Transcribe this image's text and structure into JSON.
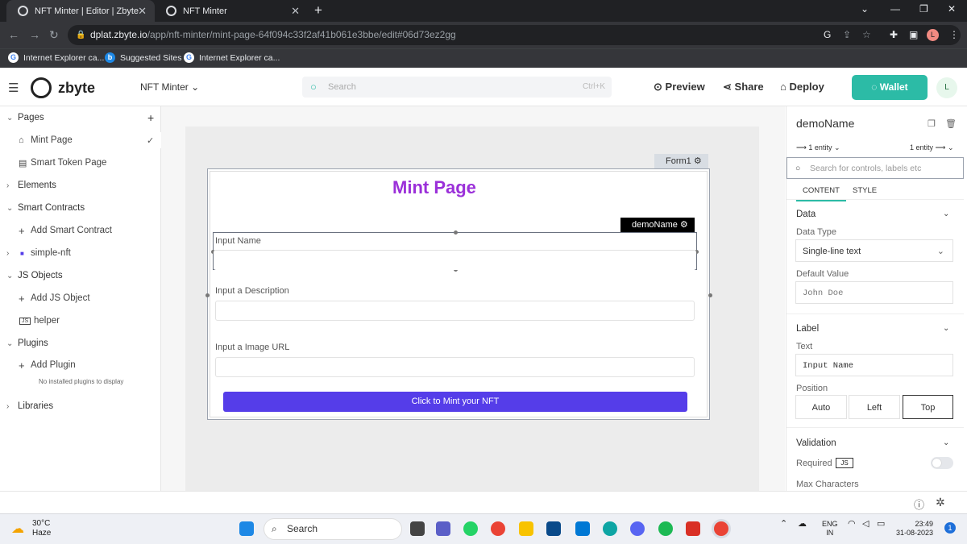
{
  "browser": {
    "tabs": [
      {
        "title": "NFT Minter | Editor | Zbyte"
      },
      {
        "title": "NFT Minter"
      }
    ],
    "url_host": "dplat.zbyte.io",
    "url_path": "/app/nft-minter/mint-page-64f094c33f2af41b061e3bbe/edit#06d73ez2gg",
    "profile_initial": "L",
    "bookmarks": [
      "Internet Explorer ca...",
      "Suggested Sites",
      "Internet Explorer ca..."
    ]
  },
  "topbar": {
    "brand": "zbyte",
    "app_name": "NFT Minter",
    "search_placeholder": "Search",
    "search_shortcut": "Ctrl+K",
    "preview": "Preview",
    "share": "Share",
    "deploy": "Deploy",
    "wallet": "Wallet",
    "avatar": "L"
  },
  "sidebar": {
    "pages_header": "Pages",
    "pages": [
      "Mint Page",
      "Smart Token Page"
    ],
    "elements": "Elements",
    "smart_contracts": "Smart Contracts",
    "add_smart_contract": "Add Smart Contract",
    "contract": "simple-nft",
    "js_objects": "JS Objects",
    "add_js_object": "Add JS Object",
    "js_item": "helper",
    "plugins": "Plugins",
    "add_plugin": "Add Plugin",
    "no_plugins": "No installed plugins to display",
    "libraries": "Libraries"
  },
  "canvas": {
    "form_tag": "Form1",
    "title": "Mint Page",
    "selected_tag": "demoName",
    "fields": [
      {
        "label": "Input Name"
      },
      {
        "label": "Input a Description"
      },
      {
        "label": "Input a Image URL"
      }
    ],
    "submit": "Click to Mint your NFT"
  },
  "properties": {
    "widget_name": "demoName",
    "entity_left": "1 entity",
    "entity_right": "1 entity",
    "search_placeholder": "Search for controls, labels etc",
    "tab_content": "CONTENT",
    "tab_style": "STYLE",
    "data_section": "Data",
    "data_type_label": "Data Type",
    "data_type_value": "Single-line text",
    "default_value_label": "Default Value",
    "default_value_placeholder": "John Doe",
    "label_section": "Label",
    "text_label": "Text",
    "text_value": "Input Name",
    "position_label": "Position",
    "position_options": [
      "Auto",
      "Left",
      "Top"
    ],
    "position_selected": "Top",
    "validation_section": "Validation",
    "required_label": "Required",
    "js_badge": "JS",
    "required_on": false,
    "max_chars_label": "Max Characters"
  },
  "taskbar": {
    "temperature": "30°C",
    "condition": "Haze",
    "search": "Search",
    "lang_top": "ENG",
    "lang_bottom": "IN",
    "time": "23:49",
    "date": "31-08-2023",
    "notif_count": "1"
  }
}
